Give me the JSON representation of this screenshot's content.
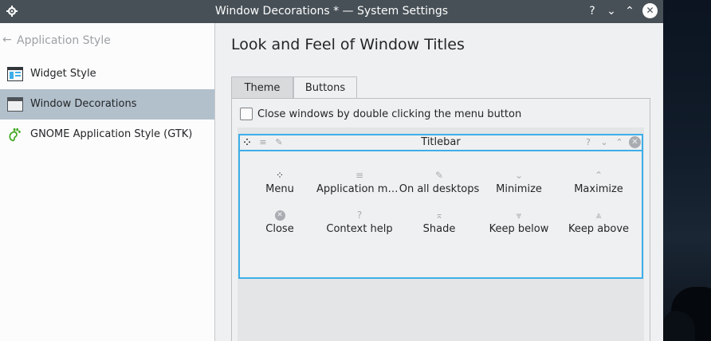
{
  "window": {
    "title": "Window Decorations * — System Settings",
    "app_icon": "gear-icon",
    "controls": {
      "help": "?",
      "minimize": "⌄",
      "maximize": "⌃",
      "close": "✕"
    }
  },
  "sidebar": {
    "back_label": "Application Style",
    "items": [
      {
        "label": "Widget Style",
        "icon": "widget-style-icon"
      },
      {
        "label": "Window Decorations",
        "icon": "window-decorations-icon",
        "active": true
      },
      {
        "label": "GNOME Application Style (GTK)",
        "icon": "gnome-foot-icon"
      }
    ]
  },
  "main": {
    "page_title": "Look and Feel of Window Titles",
    "tabs": [
      {
        "label": "Theme",
        "active": false
      },
      {
        "label": "Buttons",
        "active": true
      }
    ],
    "double_click_checkbox": {
      "label": "Close windows by double clicking the menu button",
      "checked": false
    },
    "preview_titlebar": {
      "title": "Titlebar",
      "left_buttons": [
        "menu-icon",
        "application-menu-icon",
        "pin-icon"
      ],
      "right_buttons": [
        "help-icon",
        "minimize-icon",
        "maximize-icon",
        "close-icon"
      ]
    },
    "available_buttons": [
      {
        "label": "Menu",
        "glyph": "⁘"
      },
      {
        "label": "Application menu",
        "glyph": "≡"
      },
      {
        "label": "On all desktops",
        "glyph": "✎"
      },
      {
        "label": "Minimize",
        "glyph": "⌄"
      },
      {
        "label": "Maximize",
        "glyph": "⌃"
      },
      {
        "label": "Close",
        "glyph": "✕"
      },
      {
        "label": "Context help",
        "glyph": "?"
      },
      {
        "label": "Shade",
        "glyph": "⌅"
      },
      {
        "label": "Keep below",
        "glyph": "⩔"
      },
      {
        "label": "Keep above",
        "glyph": "⩓"
      }
    ]
  },
  "colors": {
    "titlebar": "#475057",
    "selection": "#b2c0cc",
    "focus_border": "#3daee9",
    "window_bg": "#eff0f1",
    "sidebar_bg": "#fcfcfc"
  }
}
